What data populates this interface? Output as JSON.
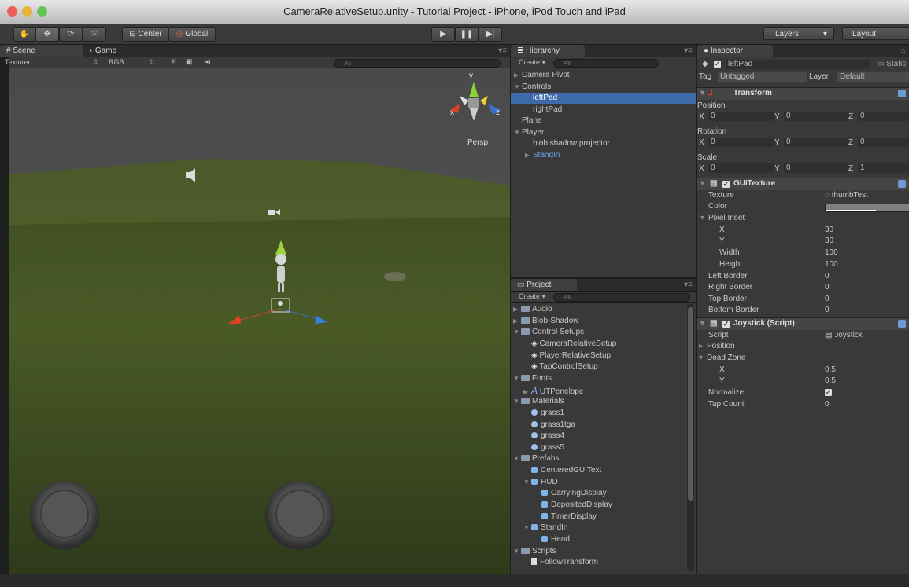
{
  "window": {
    "title": "CameraRelativeSetup.unity - Tutorial Project - iPhone, iPod Touch and iPad"
  },
  "toolbar": {
    "tool_buttons": [
      "hand-tool-icon",
      "move-tool-icon",
      "rotate-tool-icon",
      "scale-tool-icon"
    ],
    "pivot_label": "Center",
    "space_label": "Global",
    "play_icons": [
      "play-icon",
      "pause-icon",
      "step-icon"
    ],
    "layers_label": "Layers",
    "layout_label": "Layout"
  },
  "scene_panel": {
    "tabs": [
      {
        "label": "Scene",
        "active": true
      },
      {
        "label": "Game",
        "active": false
      }
    ],
    "render_mode": "Textured",
    "color_mode": "RGB",
    "search_placeholder": "All",
    "projection_label": "Persp",
    "gizmo_axes": {
      "x": "x",
      "y": "y",
      "z": "z"
    }
  },
  "hierarchy": {
    "title": "Hierarchy",
    "create_label": "Create",
    "search_placeholder": "All",
    "items": [
      {
        "label": "Camera Pivot",
        "indent": 0,
        "arrow": "right",
        "selected": false
      },
      {
        "label": "Controls",
        "indent": 0,
        "arrow": "down",
        "selected": false
      },
      {
        "label": "leftPad",
        "indent": 1,
        "arrow": "",
        "selected": true
      },
      {
        "label": "rightPad",
        "indent": 1,
        "arrow": "",
        "selected": false
      },
      {
        "label": "Plane",
        "indent": 0,
        "arrow": "",
        "selected": false
      },
      {
        "label": "Player",
        "indent": 0,
        "arrow": "down",
        "selected": false
      },
      {
        "label": "blob shadow projector",
        "indent": 1,
        "arrow": "",
        "selected": false
      },
      {
        "label": "StandIn",
        "indent": 1,
        "arrow": "right",
        "selected": false,
        "prefab": true
      }
    ]
  },
  "project": {
    "title": "Project",
    "create_label": "Create",
    "search_placeholder": "All",
    "items": [
      {
        "label": "Audio",
        "indent": 0,
        "kind": "folder",
        "arrow": "right"
      },
      {
        "label": "Blob-Shadow",
        "indent": 0,
        "kind": "folder",
        "arrow": "right"
      },
      {
        "label": "Control Setups",
        "indent": 0,
        "kind": "folder",
        "arrow": "down"
      },
      {
        "label": "CameraRelativeSetup",
        "indent": 1,
        "kind": "scene",
        "arrow": ""
      },
      {
        "label": "PlayerRelativeSetup",
        "indent": 1,
        "kind": "scene",
        "arrow": ""
      },
      {
        "label": "TapControlSetup",
        "indent": 1,
        "kind": "scene",
        "arrow": ""
      },
      {
        "label": "Fonts",
        "indent": 0,
        "kind": "folder",
        "arrow": "down"
      },
      {
        "label": "UTPenelope",
        "indent": 1,
        "kind": "font",
        "arrow": "right"
      },
      {
        "label": "Materials",
        "indent": 0,
        "kind": "folder",
        "arrow": "down"
      },
      {
        "label": "grass1",
        "indent": 1,
        "kind": "material",
        "arrow": ""
      },
      {
        "label": "grass1tga",
        "indent": 1,
        "kind": "material",
        "arrow": ""
      },
      {
        "label": "grass4",
        "indent": 1,
        "kind": "material",
        "arrow": ""
      },
      {
        "label": "grass5",
        "indent": 1,
        "kind": "material",
        "arrow": ""
      },
      {
        "label": "Prefabs",
        "indent": 0,
        "kind": "folder",
        "arrow": "down"
      },
      {
        "label": "CenteredGUIText",
        "indent": 1,
        "kind": "prefab",
        "arrow": ""
      },
      {
        "label": "HUD",
        "indent": 1,
        "kind": "prefab",
        "arrow": "down"
      },
      {
        "label": "CarryingDisplay",
        "indent": 2,
        "kind": "prefab",
        "arrow": ""
      },
      {
        "label": "DepositedDisplay",
        "indent": 2,
        "kind": "prefab",
        "arrow": ""
      },
      {
        "label": "TimerDisplay",
        "indent": 2,
        "kind": "prefab",
        "arrow": ""
      },
      {
        "label": "StandIn",
        "indent": 1,
        "kind": "prefab",
        "arrow": "down"
      },
      {
        "label": "Head",
        "indent": 2,
        "kind": "prefab",
        "arrow": ""
      },
      {
        "label": "Scripts",
        "indent": 0,
        "kind": "folder",
        "arrow": "down"
      },
      {
        "label": "FollowTransform",
        "indent": 1,
        "kind": "script",
        "arrow": ""
      }
    ]
  },
  "inspector": {
    "title": "Inspector",
    "object_name": "leftPad",
    "static_label": "Static",
    "tag_label": "Tag",
    "tag_value": "Untagged",
    "layer_label": "Layer",
    "layer_value": "Default",
    "transform": {
      "title": "Transform",
      "position_label": "Position",
      "rotation_label": "Rotation",
      "scale_label": "Scale",
      "axis_x": "X",
      "axis_y": "Y",
      "axis_z": "Z",
      "position": [
        "0",
        "0",
        "0"
      ],
      "rotation": [
        "0",
        "0",
        "0"
      ],
      "scale": [
        "0",
        "0",
        "1"
      ]
    },
    "gui_texture": {
      "title": "GUITexture",
      "texture_label": "Texture",
      "texture_value": "thumbTest",
      "color_label": "Color",
      "pixel_inset_label": "Pixel Inset",
      "x_label": "X",
      "x_value": "30",
      "y_label": "Y",
      "y_value": "30",
      "width_label": "Width",
      "width_value": "100",
      "height_label": "Height",
      "height_value": "100",
      "left_border_label": "Left Border",
      "left_border_value": "0",
      "right_border_label": "Right Border",
      "right_border_value": "0",
      "top_border_label": "Top Border",
      "top_border_value": "0",
      "bottom_border_label": "Bottom Border",
      "bottom_border_value": "0"
    },
    "joystick": {
      "title": "Joystick (Script)",
      "script_label": "Script",
      "script_value": "Joystick",
      "position_label": "Position",
      "dead_zone_label": "Dead Zone",
      "x_label": "X",
      "x_value": "0.5",
      "y_label": "Y",
      "y_value": "0.5",
      "normalize_label": "Normalize",
      "tap_count_label": "Tap Count",
      "tap_count_value": "0"
    }
  }
}
